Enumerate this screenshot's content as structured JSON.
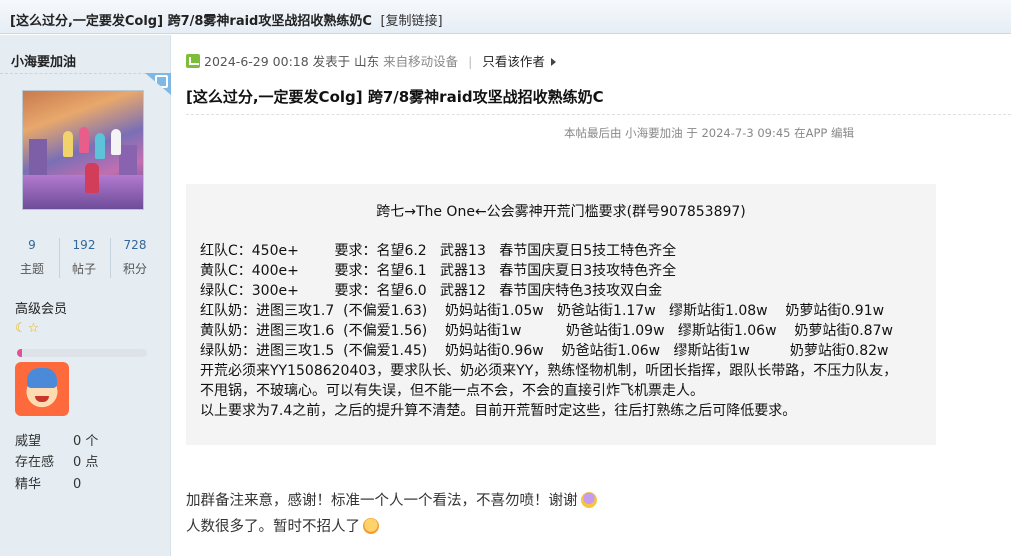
{
  "thread": {
    "title": "[这么过分,一定要发Colg] 跨7/8雾神raid攻坚战招收熟练奶C",
    "copy_link": "[复制链接]"
  },
  "author": {
    "name": "小海要加油",
    "stats": [
      {
        "value": "9",
        "label": "主题"
      },
      {
        "value": "192",
        "label": "帖子"
      },
      {
        "value": "728",
        "label": "积分"
      }
    ],
    "rank": "高级会员",
    "stars": "☾☆",
    "progress": 0.04,
    "profile": [
      {
        "key": "威望",
        "value": "0 个"
      },
      {
        "key": "存在感",
        "value": "0 点"
      },
      {
        "key": "精华",
        "value": "0"
      }
    ]
  },
  "post": {
    "date": "2024-6-29 00:18",
    "posted_in": "发表于",
    "location": "山东",
    "device": "来自移动设备",
    "only_author": "只看该作者",
    "title": "[这么过分,一定要发Colg] 跨7/8雾神raid攻坚战招收熟练奶C",
    "edited_note": "本帖最后由 小海要加油 于 2024-7-3 09:45 在APP 编辑",
    "box_title": "跨七→The One←公会雾神开荒门槛要求(群号907853897)",
    "box_lines": [
      "红队C：450e+        要求：名望6.2   武器13   春节国庆夏日5技工特色齐全",
      "黄队C：400e+        要求：名望6.1   武器13   春节国庆夏日3技攻特色齐全",
      "绿队C：300e+        要求：名望6.0   武器12   春节国庆特色3技攻双白金",
      "红队奶：进图三攻1.7  (不偏爱1.63)    奶妈站街1.05w   奶爸站街1.17w   缪斯站街1.08w    奶萝站街0.91w",
      "黄队奶：进图三攻1.6  (不偏爱1.56)    奶妈站街1w          奶爸站街1.09w   缪斯站街1.06w    奶萝站街0.87w",
      "绿队奶：进图三攻1.5  (不偏爱1.45)    奶妈站街0.96w    奶爸站街1.06w   缪斯站街1w         奶萝站街0.82w",
      "开荒必须来YY1508620403，要求队长、奶必须来YY，熟练怪物机制，听团长指挥，跟队长带路，不压力队友，",
      "不甩锅，不玻璃心。可以有失误，但不能一点不会，不会的直接引炸飞机票走人。",
      "以上要求为7.4之前，之后的提升算不清楚。目前开荒暂时定这些，往后打熟练之后可降低要求。"
    ],
    "after_lines": [
      "加群备注来意，感谢！标准一个人一个看法，不喜勿喷！谢谢",
      "人数很多了。暂时不招人了"
    ]
  }
}
